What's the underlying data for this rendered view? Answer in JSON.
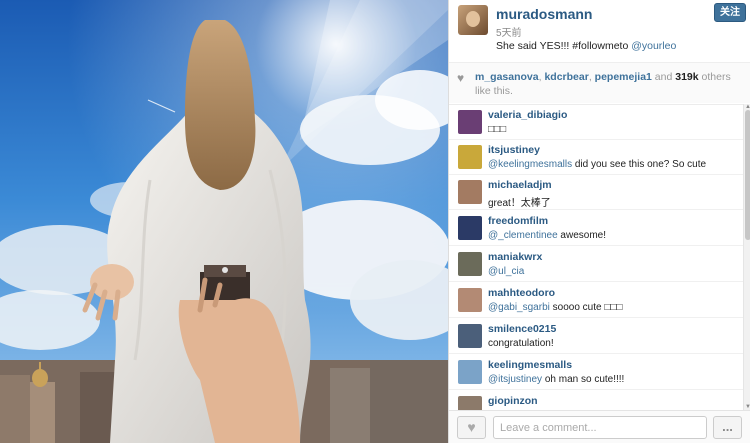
{
  "post": {
    "username": "muradosmann",
    "time": "5天前",
    "caption_text": "She said YES!!! #followmeto ",
    "caption_mention": "@yourleo",
    "follow_label": "关注"
  },
  "likes": {
    "users": [
      "m_gasanova",
      "kdcrbear",
      "pepemejia1"
    ],
    "sep1": ", ",
    "sep2": ", ",
    "and_text": " and ",
    "count": "319k",
    "suffix": " others like this."
  },
  "comments": [
    {
      "user": "valeria_dibiagio",
      "mention": "",
      "text": "□□□",
      "avatar_color": "#6a3e74"
    },
    {
      "user": "itsjustiney",
      "mention": "@keelingmesmalls",
      "text": " did you see this one? So cute",
      "avatar_color": "#c9a83a"
    },
    {
      "user": "michaeladjm",
      "mention": "",
      "text": "great！太棒了",
      "avatar_color": "#a37b62"
    },
    {
      "user": "freedomfilm",
      "mention": "@_clementinee",
      "text": " awesome!",
      "avatar_color": "#2b3a66"
    },
    {
      "user": "maniakwrx",
      "mention": "@ul_cia",
      "text": "",
      "avatar_color": "#6b6b5a"
    },
    {
      "user": "mahhteodoro",
      "mention": "@gabi_sgarbi",
      "text": " soooo cute □□□",
      "avatar_color": "#b38a74"
    },
    {
      "user": "smilence0215",
      "mention": "",
      "text": "congratulation!",
      "avatar_color": "#4b5f7a"
    },
    {
      "user": "keelingmesmalls",
      "mention": "@itsjustiney",
      "text": " oh man so cute!!!!",
      "avatar_color": "#7ba3c8"
    },
    {
      "user": "giopinzon",
      "mention": "",
      "text": "",
      "avatar_color": "#8c7a6a"
    }
  ],
  "footer": {
    "placeholder": "Leave a comment...",
    "more_label": "..."
  },
  "icons": {
    "heart": "heart-icon",
    "like": "like-heart-icon",
    "more": "more-icon"
  }
}
